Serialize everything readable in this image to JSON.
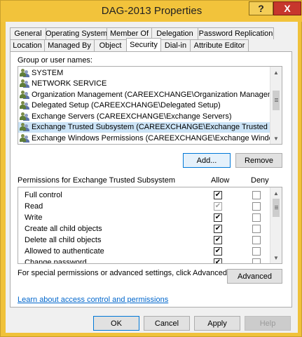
{
  "window": {
    "title": "DAG-2013 Properties",
    "help_glyph": "?",
    "close_glyph": "X"
  },
  "tabs_row1": [
    "General",
    "Operating System",
    "Member Of",
    "Delegation",
    "Password Replication"
  ],
  "tabs_row2": [
    "Location",
    "Managed By",
    "Object",
    "Security",
    "Dial-in",
    "Attribute Editor"
  ],
  "selected_tab": "Security",
  "groups_label": "Group or user names:",
  "groups": [
    "SYSTEM",
    "NETWORK SERVICE",
    "Organization Management (CAREEXCHANGE\\Organization Management)",
    "Delegated Setup (CAREEXCHANGE\\Delegated Setup)",
    "Exchange Servers (CAREEXCHANGE\\Exchange Servers)",
    "Exchange Trusted Subsystem (CAREEXCHANGE\\Exchange Trusted Subsys...",
    "Exchange Windows Permissions (CAREEXCHANGE\\Exchange Windows Pe..."
  ],
  "selected_group_index": 5,
  "buttons": {
    "add": "Add...",
    "remove": "Remove",
    "advanced": "Advanced",
    "ok": "OK",
    "cancel": "Cancel",
    "apply": "Apply",
    "help": "Help"
  },
  "permissions_label": "Permissions for Exchange Trusted Subsystem",
  "allow_header": "Allow",
  "deny_header": "Deny",
  "permissions": [
    {
      "name": "Full control",
      "allow": "checked",
      "deny": "unchecked"
    },
    {
      "name": "Read",
      "allow": "checked-disabled",
      "deny": "unchecked"
    },
    {
      "name": "Write",
      "allow": "checked",
      "deny": "unchecked"
    },
    {
      "name": "Create all child objects",
      "allow": "checked",
      "deny": "unchecked"
    },
    {
      "name": "Delete all child objects",
      "allow": "checked",
      "deny": "unchecked"
    },
    {
      "name": "Allowed to authenticate",
      "allow": "checked",
      "deny": "unchecked"
    },
    {
      "name": "Change password",
      "allow": "checked",
      "deny": "unchecked"
    }
  ],
  "advanced_note": "For special permissions or advanced settings, click Advanced.",
  "learn_link": "Learn about access control and permissions",
  "colors": {
    "titlebar": "#f2c33b",
    "close": "#c7372d",
    "selection": "#cce4f7",
    "link": "#0066cc"
  }
}
